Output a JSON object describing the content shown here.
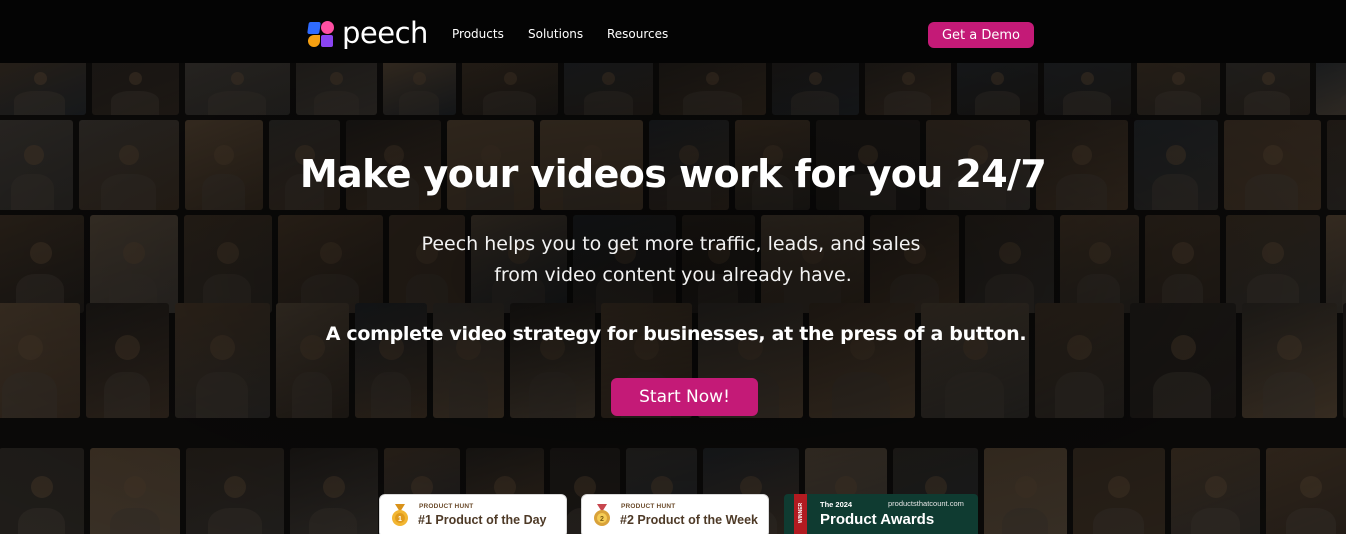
{
  "brand": {
    "logo_text": "peech",
    "logo_icon": "peech-logo-icon",
    "accent_color": "#c41a77"
  },
  "nav": {
    "items": [
      {
        "label": "Products"
      },
      {
        "label": "Solutions"
      },
      {
        "label": "Resources"
      }
    ],
    "cta_label": "Get a Demo"
  },
  "hero": {
    "headline": "Make your videos work for you 24/7",
    "subline_1": "Peech helps you to get more traffic, leads, and sales",
    "subline_2": "from video content you already have.",
    "tagline": "A complete video strategy for businesses, at the press of a button.",
    "cta_label": "Start Now!",
    "background": "video-grid-collage"
  },
  "badges": [
    {
      "kicker": "PRODUCT HUNT",
      "title": "#1 Product of the Day",
      "icon": "gold-medal-icon"
    },
    {
      "kicker": "PRODUCT HUNT",
      "title": "#2 Product of the Week",
      "icon": "silver-medal-icon"
    },
    {
      "ribbon": "WINNER",
      "year_line": "The 2024",
      "site": "productsthatcount.com",
      "title": "Product Awards"
    }
  ]
}
